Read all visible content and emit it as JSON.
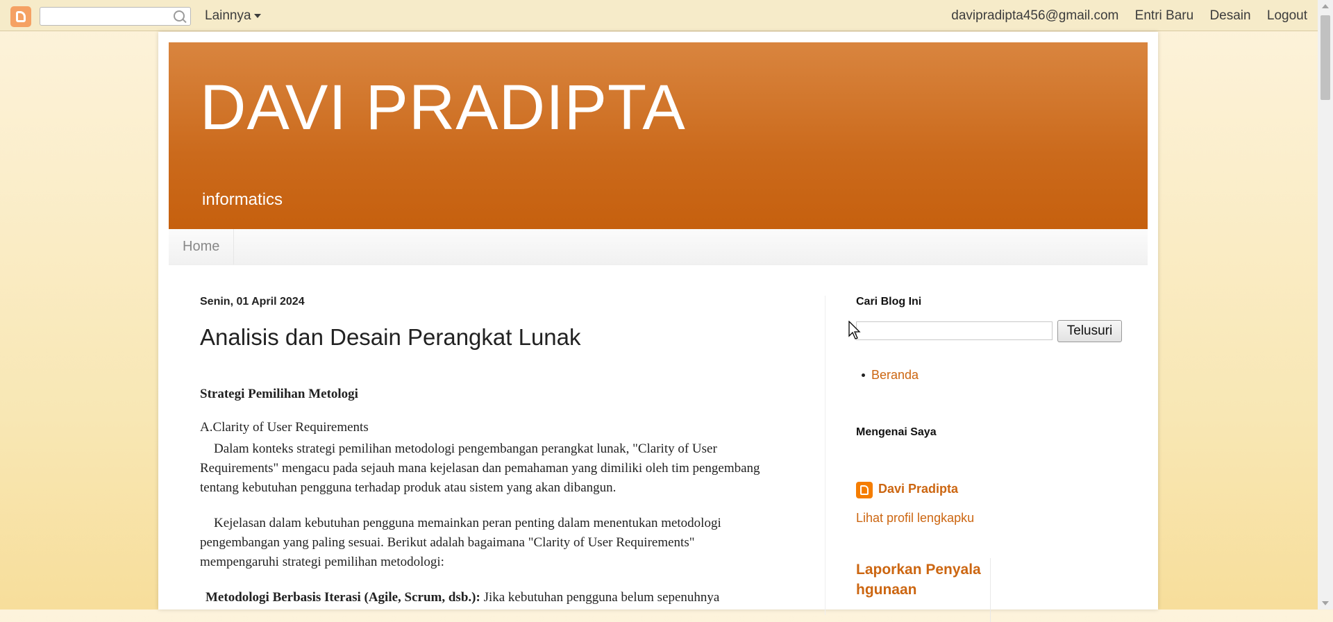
{
  "navbar": {
    "more_label": "Lainnya",
    "email": "davipradipta456@gmail.com",
    "new_post": "Entri Baru",
    "design": "Desain",
    "logout": "Logout"
  },
  "header": {
    "title": "DAVI PRADIPTA",
    "description": "informatics"
  },
  "tabs": {
    "home": "Home"
  },
  "post": {
    "date": "Senin, 01 April 2024",
    "title": "Analisis dan Desain Perangkat Lunak",
    "section_heading": "Strategi Pemilihan Metologi",
    "subheading": "A.Clarity of User Requirements",
    "paragraph1": "Dalam konteks strategi pemilihan metodologi pengembangan perangkat lunak, \"Clarity of User Requirements\" mengacu pada sejauh mana kejelasan dan pemahaman yang dimiliki oleh tim pengembang tentang kebutuhan pengguna terhadap produk atau sistem yang akan dibangun.",
    "paragraph2": "Kejelasan dalam kebutuhan pengguna memainkan peran penting dalam menentukan metodologi pengembangan yang paling sesuai. Berikut adalah bagaimana \"Clarity of User Requirements\" mempengaruhi strategi pemilihan metodologi:",
    "list_lead_bold": "Metodologi Berbasis Iterasi (Agile, Scrum, dsb.):",
    "list_lead_text": " Jika kebutuhan pengguna belum sepenuhnya"
  },
  "sidebar": {
    "search_title": "Cari Blog Ini",
    "search_button": "Telusuri",
    "pages": [
      "Beranda"
    ],
    "about_title": "Mengenai Saya",
    "profile_name": "Davi Pradipta",
    "profile_link": "Lihat profil lengkapku",
    "report_title": "Laporkan Penyalahgunaan"
  },
  "colors": {
    "header_orange": "#cb6a1c",
    "link_orange": "#cc6611",
    "navbar_bg": "#f6ebc9"
  }
}
